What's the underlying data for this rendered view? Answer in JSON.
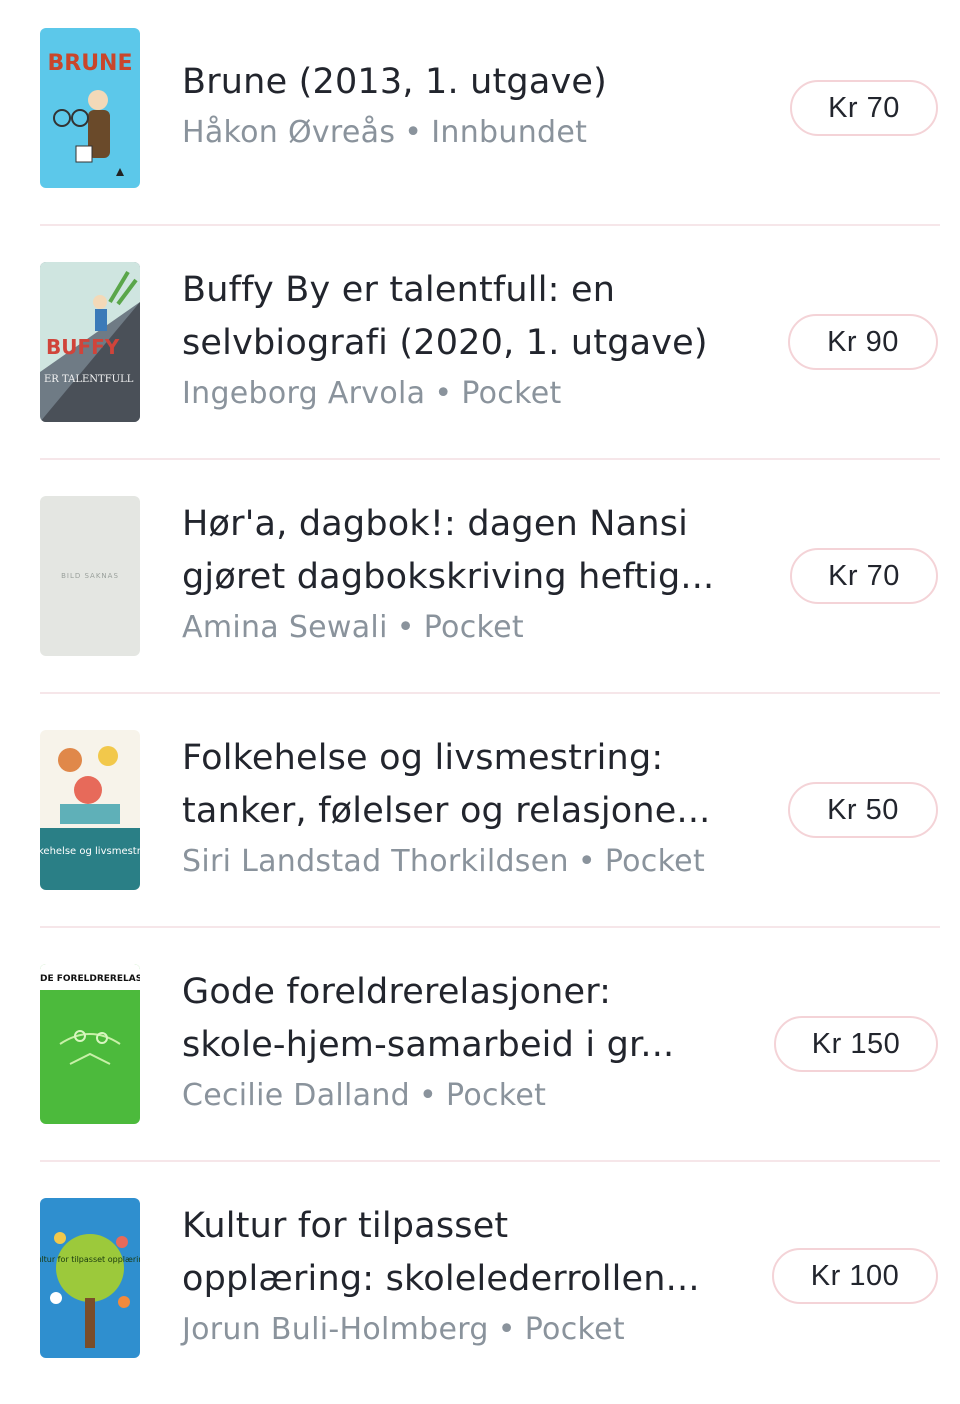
{
  "items": [
    {
      "title": "Brune (2013, 1. utgave)",
      "title_line2": "",
      "author": "Håkon Øvreås",
      "format": "Innbundet",
      "price": "Kr 70",
      "cover_label": "BRUNE"
    },
    {
      "title": "Buffy By er talentfull: en",
      "title_line2": "selvbiografi (2020, 1. utgave)",
      "author": "Ingeborg Arvola",
      "format": "Pocket",
      "price": "Kr 90",
      "cover_label": "ER TALENTFULL"
    },
    {
      "title": "Hør'a, dagbok!: dagen Nansi",
      "title_line2": "gjøret dagbokskriving heftig...",
      "author": "Amina Sewali",
      "format": "Pocket",
      "price": "Kr 70",
      "cover_label": "BILD SAKNAS"
    },
    {
      "title": "Folkehelse og livsmestring:",
      "title_line2": "tanker, følelser og relasjone...",
      "author": "Siri Landstad Thorkildsen",
      "format": "Pocket",
      "price": "Kr 50",
      "cover_label": "Folkehelse og livsmestring"
    },
    {
      "title": "Gode foreldrerelasjoner:",
      "title_line2": "skole-hjem-samarbeid i gr...",
      "author": "Cecilie Dalland",
      "format": "Pocket",
      "price": "Kr 150",
      "cover_label": "DE FORELDRERELASJONI"
    },
    {
      "title": "Kultur for tilpasset",
      "title_line2": "opplæring: skolelederrollen...",
      "author": "Jorun Buli-Holmberg",
      "format": "Pocket",
      "price": "Kr 100",
      "cover_label": "Kultur for tilpasset opplæring"
    }
  ],
  "separator": "•",
  "colors": {
    "price_border": "#f4d3d7",
    "divider": "#f6e6e9",
    "meta_text": "#8a939c"
  }
}
